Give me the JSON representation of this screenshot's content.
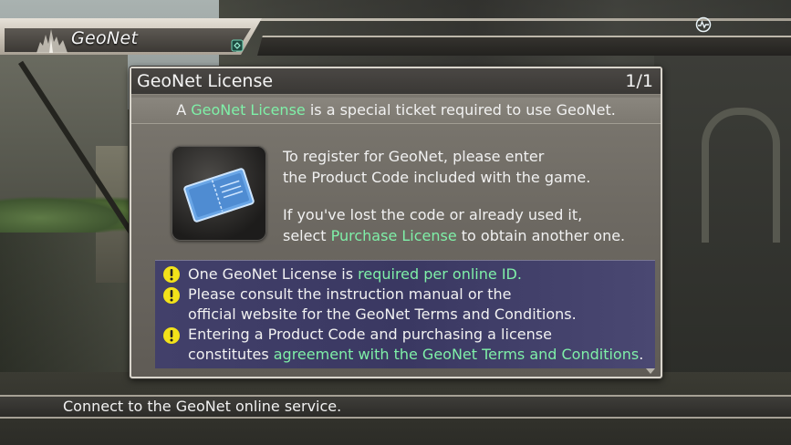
{
  "header": {
    "title": "GeoNet",
    "emblem_icon": "castle-emblem-icon",
    "link_icon": "network-link-icon",
    "status_icon": "network-status-icon"
  },
  "dialog": {
    "title": "GeoNet License",
    "page": "1/1",
    "subtitle": {
      "before": "A ",
      "highlight": "GeoNet License",
      "after": " is a special ticket required to use GeoNet."
    },
    "ticket_icon": "ticket-icon",
    "body": {
      "line1": "To register for GeoNet, please enter",
      "line2": "the Product Code included with the game.",
      "line3": "If you've lost the code or already used it,",
      "line4_before": "select ",
      "line4_highlight": "Purchase License",
      "line4_after": " to obtain another one."
    },
    "notes": {
      "n1_before": "One GeoNet License is ",
      "n1_highlight": "required per online ID.",
      "n2_line1": "Please consult the instruction manual or the",
      "n2_line2": "official website for the GeoNet Terms and Conditions.",
      "n3_line1": "Entering a Product Code and purchasing a license",
      "n3_before": "constitutes ",
      "n3_highlight": "agreement with the GeoNet Terms and Conditions",
      "n3_after": "."
    }
  },
  "footer": {
    "help_text": "Connect to the GeoNet online service."
  },
  "colors": {
    "highlight": "#7ff0a8",
    "warning": "#f2e21a",
    "notice_bg": "#3a3862"
  }
}
